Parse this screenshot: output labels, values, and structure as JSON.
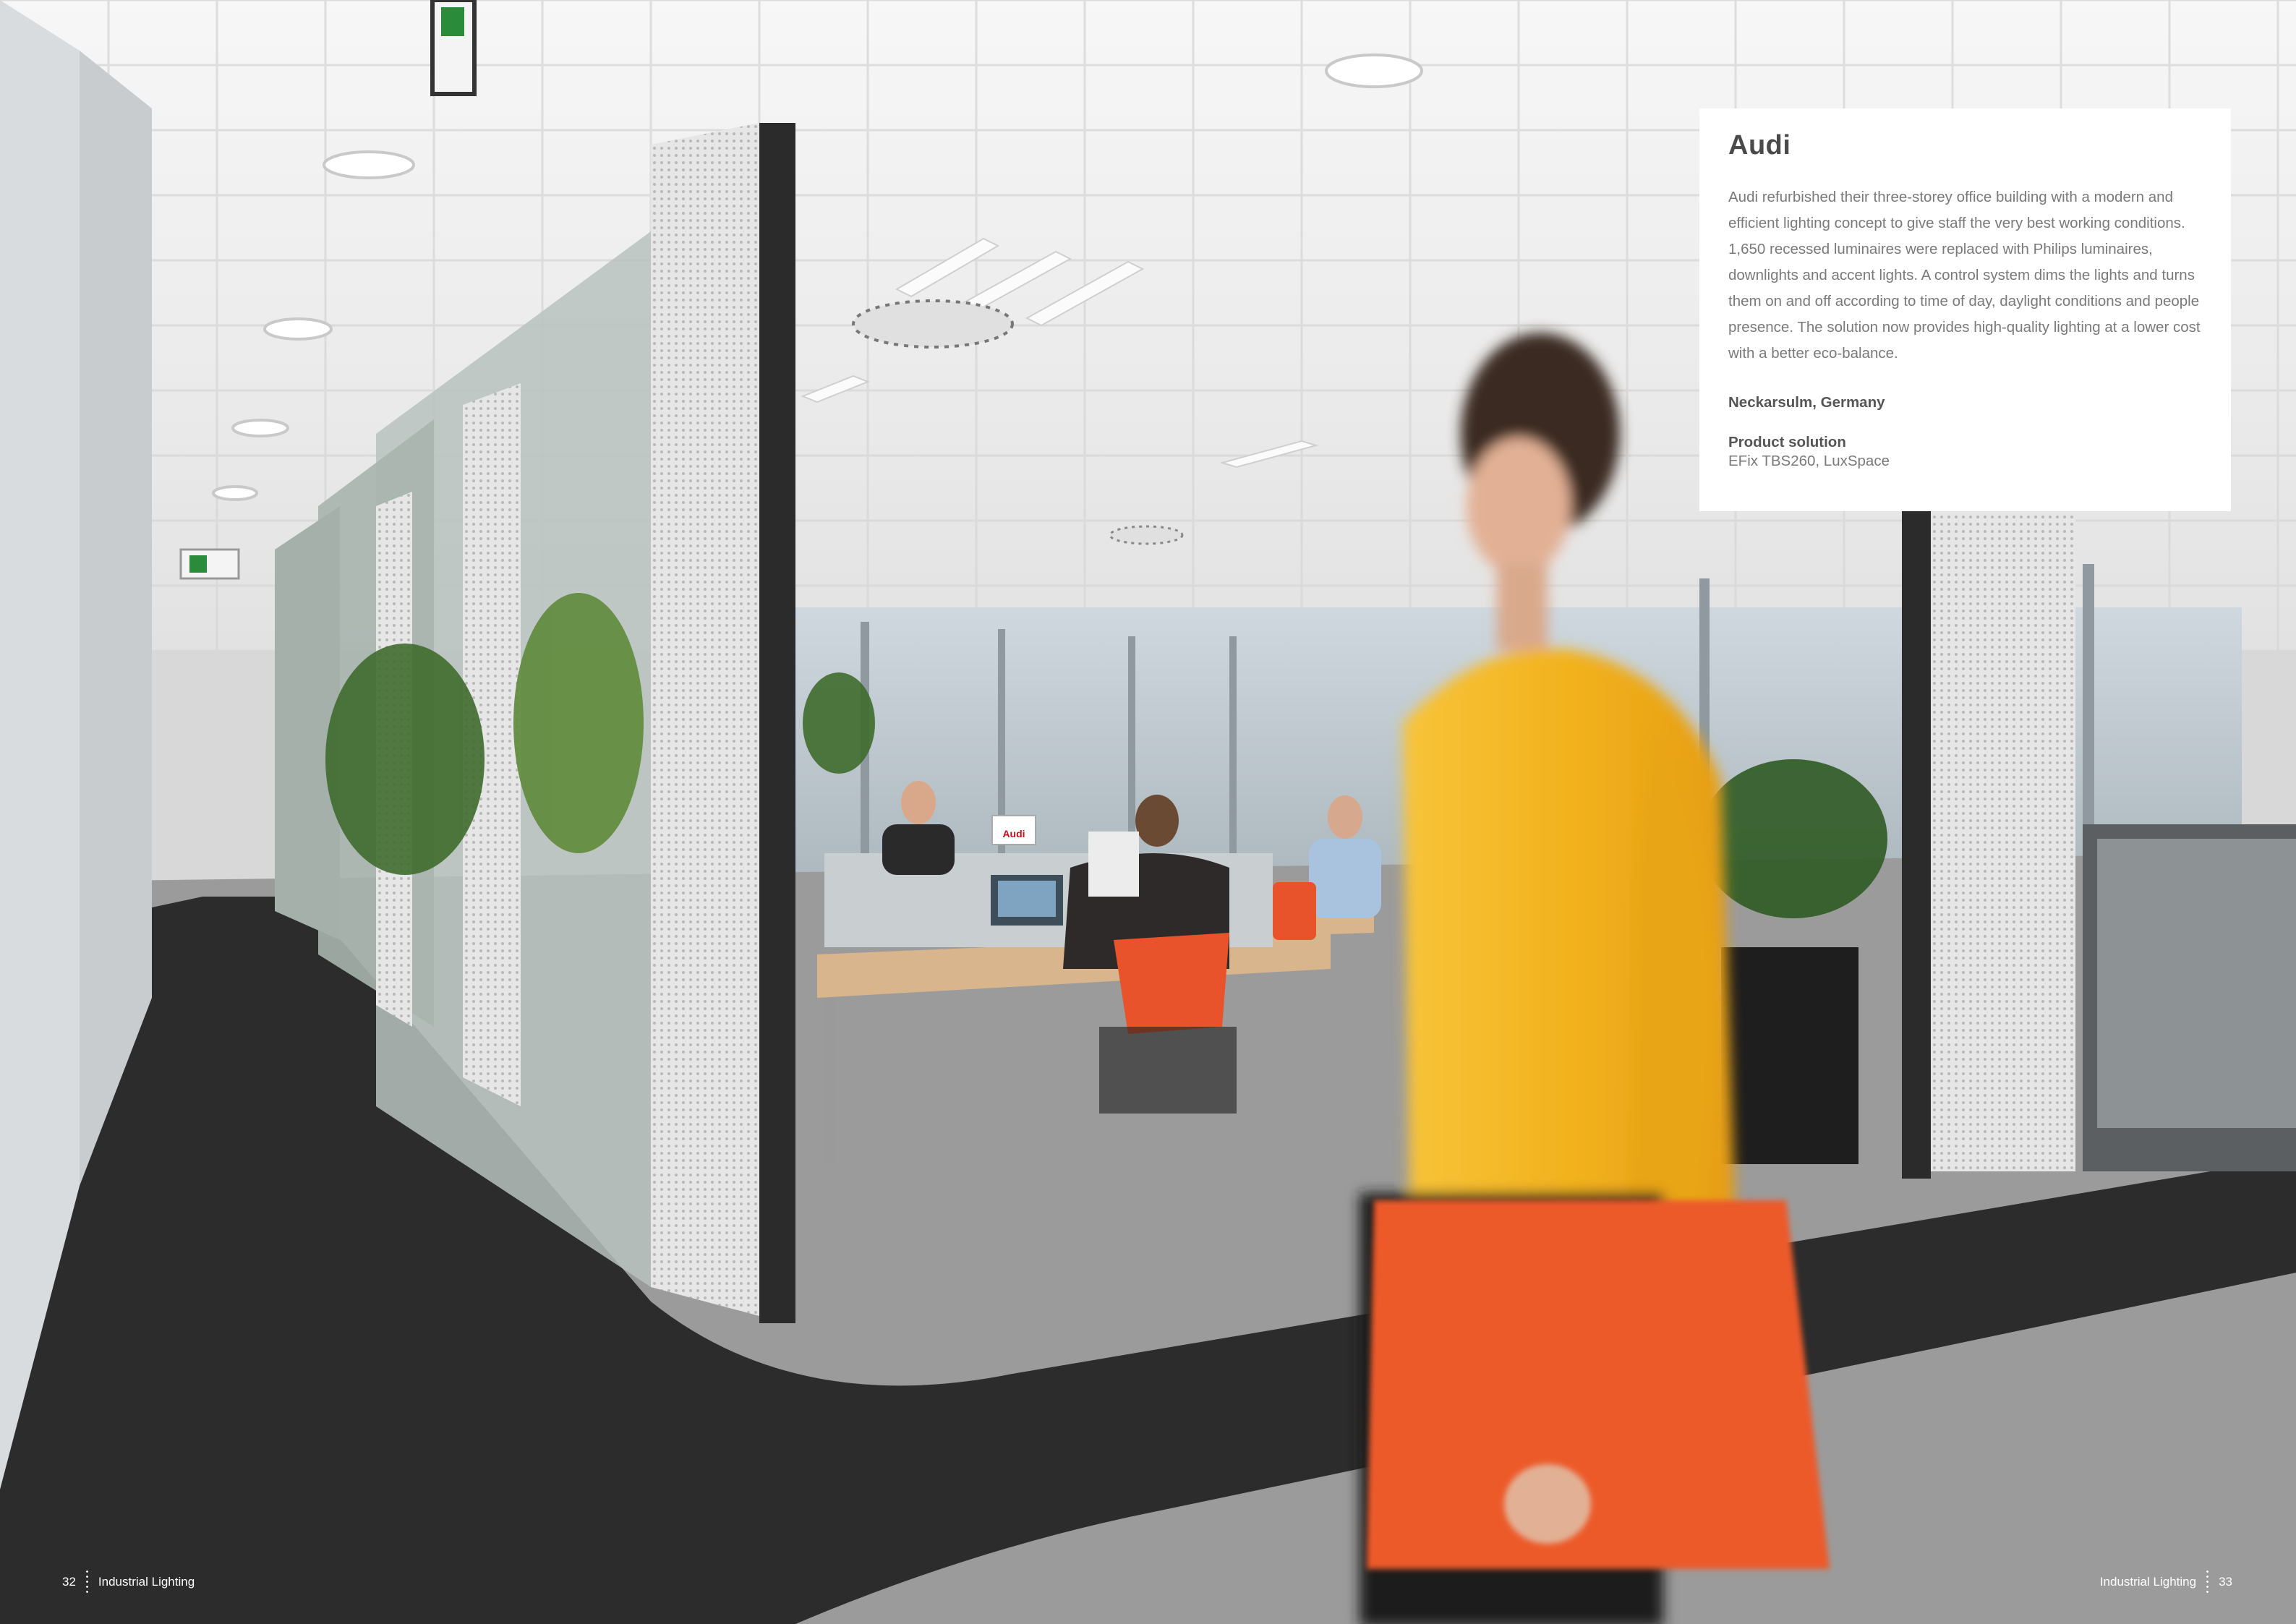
{
  "card": {
    "title": "Audi",
    "body": "Audi refurbished their three-storey office building with a modern and efficient lighting concept to give staff the very best working conditions. 1,650 recessed luminaires were replaced with Philips luminaires, downlights and accent lights. A control system dims the lights and turns them on and off according to time of day, daylight conditions and people presence. The solution now provides high-quality lighting at a lower cost with a better eco-balance.",
    "location": "Neckarsulm, Germany",
    "product_label": "Product solution",
    "product_value": "EFix TBS260, LuxSpace"
  },
  "footer": {
    "left_page": "32",
    "left_section": "Industrial Lighting",
    "right_section": "Industrial Lighting",
    "right_page": "33"
  },
  "photo": {
    "sign_text": "Audi"
  },
  "colors": {
    "sweater": "#f2b21e",
    "folder": "#ec5a2a",
    "chair": "#e8532b",
    "carpet_dark": "#2c2c2c",
    "carpet_light": "#9a9a9a",
    "ceiling": "#f4f4f4"
  }
}
